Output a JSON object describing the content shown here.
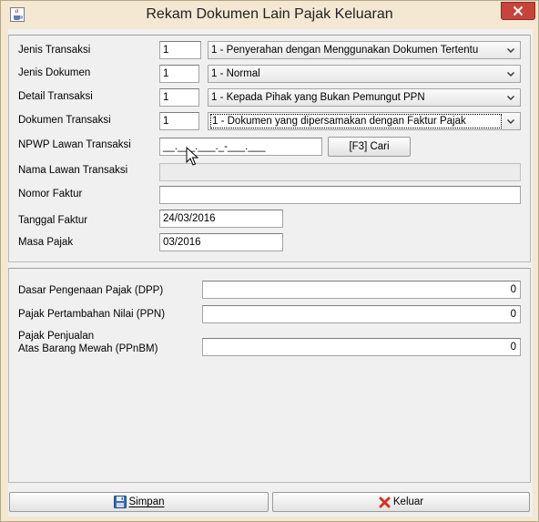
{
  "window": {
    "title": "Rekam Dokumen Lain Pajak Keluaran",
    "close_symbol": "×"
  },
  "form": {
    "jenis_transaksi": {
      "label": "Jenis Transaksi",
      "code": "1",
      "selected": "1 - Penyerahan dengan Menggunakan Dokumen Tertentu"
    },
    "jenis_dokumen": {
      "label": "Jenis Dokumen",
      "code": "1",
      "selected": "1 - Normal"
    },
    "detail_transaksi": {
      "label": "Detail Transaksi",
      "code": "1",
      "selected": "1 - Kepada Pihak yang Bukan Pemungut PPN"
    },
    "dokumen_transaksi": {
      "label": "Dokumen Transaksi",
      "code": "1",
      "selected": "1 - Dokumen yang dipersamakan dengan Faktur Pajak"
    },
    "npwp": {
      "label": "NPWP Lawan Transaksi",
      "value": "__.___.___._-___.___",
      "cari_label": "[F3] Cari"
    },
    "nama_lawan": {
      "label": "Nama Lawan Transaksi",
      "value": ""
    },
    "nomor_faktur": {
      "label": "Nomor Faktur",
      "value": ""
    },
    "tanggal_faktur": {
      "label": "Tanggal Faktur",
      "value": "24/03/2016"
    },
    "masa_pajak": {
      "label": "Masa Pajak",
      "value": "03/2016"
    }
  },
  "amounts": {
    "dpp": {
      "label": "Dasar Pengenaan Pajak (DPP)",
      "value": "0"
    },
    "ppn": {
      "label": "Pajak Pertambahan Nilai (PPN)",
      "value": "0"
    },
    "ppnbm": {
      "label_line1": "Pajak Penjualan",
      "label_line2": "Atas Barang Mewah (PPnBM)",
      "value": "0"
    }
  },
  "buttons": {
    "simpan": "Simpan",
    "keluar": "Keluar"
  },
  "icons": {
    "app": "java-cup-icon",
    "save": "floppy-disk-icon",
    "exit": "red-x-icon",
    "dropdown": "chevron-down-icon",
    "pointer": "mouse-cursor-icon"
  }
}
